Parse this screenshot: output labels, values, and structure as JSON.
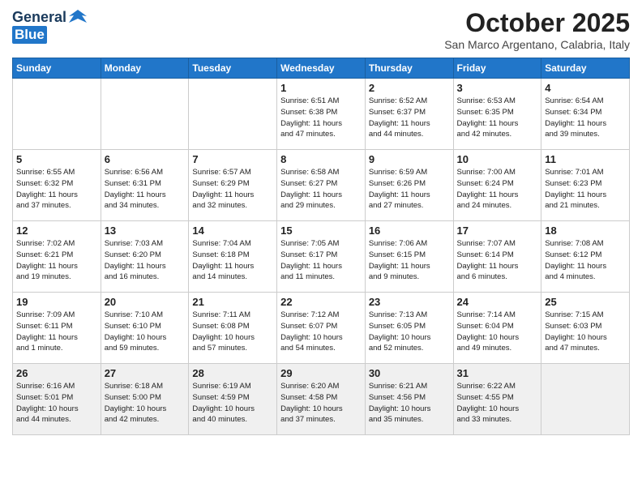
{
  "logo": {
    "general": "General",
    "blue": "Blue"
  },
  "header": {
    "title": "October 2025",
    "subtitle": "San Marco Argentano, Calabria, Italy"
  },
  "weekdays": [
    "Sunday",
    "Monday",
    "Tuesday",
    "Wednesday",
    "Thursday",
    "Friday",
    "Saturday"
  ],
  "weeks": [
    [
      {
        "day": "",
        "detail": ""
      },
      {
        "day": "",
        "detail": ""
      },
      {
        "day": "",
        "detail": ""
      },
      {
        "day": "1",
        "detail": "Sunrise: 6:51 AM\nSunset: 6:38 PM\nDaylight: 11 hours\nand 47 minutes."
      },
      {
        "day": "2",
        "detail": "Sunrise: 6:52 AM\nSunset: 6:37 PM\nDaylight: 11 hours\nand 44 minutes."
      },
      {
        "day": "3",
        "detail": "Sunrise: 6:53 AM\nSunset: 6:35 PM\nDaylight: 11 hours\nand 42 minutes."
      },
      {
        "day": "4",
        "detail": "Sunrise: 6:54 AM\nSunset: 6:34 PM\nDaylight: 11 hours\nand 39 minutes."
      }
    ],
    [
      {
        "day": "5",
        "detail": "Sunrise: 6:55 AM\nSunset: 6:32 PM\nDaylight: 11 hours\nand 37 minutes."
      },
      {
        "day": "6",
        "detail": "Sunrise: 6:56 AM\nSunset: 6:31 PM\nDaylight: 11 hours\nand 34 minutes."
      },
      {
        "day": "7",
        "detail": "Sunrise: 6:57 AM\nSunset: 6:29 PM\nDaylight: 11 hours\nand 32 minutes."
      },
      {
        "day": "8",
        "detail": "Sunrise: 6:58 AM\nSunset: 6:27 PM\nDaylight: 11 hours\nand 29 minutes."
      },
      {
        "day": "9",
        "detail": "Sunrise: 6:59 AM\nSunset: 6:26 PM\nDaylight: 11 hours\nand 27 minutes."
      },
      {
        "day": "10",
        "detail": "Sunrise: 7:00 AM\nSunset: 6:24 PM\nDaylight: 11 hours\nand 24 minutes."
      },
      {
        "day": "11",
        "detail": "Sunrise: 7:01 AM\nSunset: 6:23 PM\nDaylight: 11 hours\nand 21 minutes."
      }
    ],
    [
      {
        "day": "12",
        "detail": "Sunrise: 7:02 AM\nSunset: 6:21 PM\nDaylight: 11 hours\nand 19 minutes."
      },
      {
        "day": "13",
        "detail": "Sunrise: 7:03 AM\nSunset: 6:20 PM\nDaylight: 11 hours\nand 16 minutes."
      },
      {
        "day": "14",
        "detail": "Sunrise: 7:04 AM\nSunset: 6:18 PM\nDaylight: 11 hours\nand 14 minutes."
      },
      {
        "day": "15",
        "detail": "Sunrise: 7:05 AM\nSunset: 6:17 PM\nDaylight: 11 hours\nand 11 minutes."
      },
      {
        "day": "16",
        "detail": "Sunrise: 7:06 AM\nSunset: 6:15 PM\nDaylight: 11 hours\nand 9 minutes."
      },
      {
        "day": "17",
        "detail": "Sunrise: 7:07 AM\nSunset: 6:14 PM\nDaylight: 11 hours\nand 6 minutes."
      },
      {
        "day": "18",
        "detail": "Sunrise: 7:08 AM\nSunset: 6:12 PM\nDaylight: 11 hours\nand 4 minutes."
      }
    ],
    [
      {
        "day": "19",
        "detail": "Sunrise: 7:09 AM\nSunset: 6:11 PM\nDaylight: 11 hours\nand 1 minute."
      },
      {
        "day": "20",
        "detail": "Sunrise: 7:10 AM\nSunset: 6:10 PM\nDaylight: 10 hours\nand 59 minutes."
      },
      {
        "day": "21",
        "detail": "Sunrise: 7:11 AM\nSunset: 6:08 PM\nDaylight: 10 hours\nand 57 minutes."
      },
      {
        "day": "22",
        "detail": "Sunrise: 7:12 AM\nSunset: 6:07 PM\nDaylight: 10 hours\nand 54 minutes."
      },
      {
        "day": "23",
        "detail": "Sunrise: 7:13 AM\nSunset: 6:05 PM\nDaylight: 10 hours\nand 52 minutes."
      },
      {
        "day": "24",
        "detail": "Sunrise: 7:14 AM\nSunset: 6:04 PM\nDaylight: 10 hours\nand 49 minutes."
      },
      {
        "day": "25",
        "detail": "Sunrise: 7:15 AM\nSunset: 6:03 PM\nDaylight: 10 hours\nand 47 minutes."
      }
    ],
    [
      {
        "day": "26",
        "detail": "Sunrise: 6:16 AM\nSunset: 5:01 PM\nDaylight: 10 hours\nand 44 minutes."
      },
      {
        "day": "27",
        "detail": "Sunrise: 6:18 AM\nSunset: 5:00 PM\nDaylight: 10 hours\nand 42 minutes."
      },
      {
        "day": "28",
        "detail": "Sunrise: 6:19 AM\nSunset: 4:59 PM\nDaylight: 10 hours\nand 40 minutes."
      },
      {
        "day": "29",
        "detail": "Sunrise: 6:20 AM\nSunset: 4:58 PM\nDaylight: 10 hours\nand 37 minutes."
      },
      {
        "day": "30",
        "detail": "Sunrise: 6:21 AM\nSunset: 4:56 PM\nDaylight: 10 hours\nand 35 minutes."
      },
      {
        "day": "31",
        "detail": "Sunrise: 6:22 AM\nSunset: 4:55 PM\nDaylight: 10 hours\nand 33 minutes."
      },
      {
        "day": "",
        "detail": ""
      }
    ]
  ]
}
